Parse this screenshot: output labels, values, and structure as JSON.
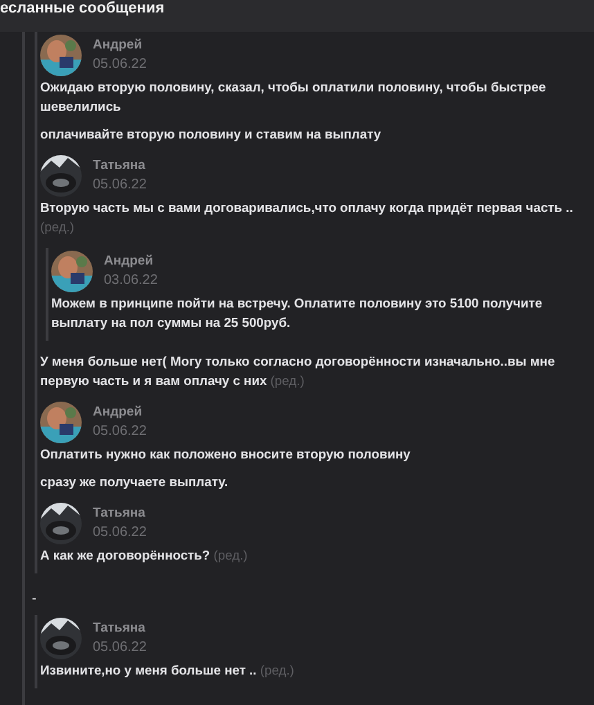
{
  "header": {
    "title": "есланные сообщения"
  },
  "items": [
    {
      "kind": "forward",
      "messages": [
        {
          "author": "Андрей",
          "date": "05.06.22",
          "avatar": {
            "kind": "picture"
          },
          "body": [
            {
              "kind": "text",
              "text": "Ожидаю вторую половину, сказал, чтобы оплатили половину, чтобы быстрее шевелились"
            },
            {
              "kind": "text",
              "text": "оплачивайте вторую половину и ставим на выплату"
            }
          ]
        },
        {
          "author": "Татьяна",
          "date": "05.06.22",
          "avatar": {
            "kind": "picture"
          },
          "body": [
            {
              "kind": "text",
              "text": "Вторую часть мы с вами договаривались,что оплачу когда придёт первая часть ..",
              "edit_mark": "(ред.)"
            },
            {
              "kind": "forward",
              "messages": [
                {
                  "author": "Андрей",
                  "date": "03.06.22",
                  "avatar": {
                    "kind": "picture"
                  },
                  "body": [
                    {
                      "kind": "text",
                      "text": "Можем в принципе пойти на встречу. Оплатите половину это 5100 получите выплату на пол суммы на 25 500руб."
                    }
                  ]
                }
              ]
            },
            {
              "kind": "text",
              "text": "У меня больше нет( Могу только согласно договорённости изначально..вы мне первую часть и я вам оплачу с них",
              "edit_mark": "(ред.)"
            }
          ]
        },
        {
          "author": "Андрей",
          "date": "05.06.22",
          "avatar": {
            "kind": "picture"
          },
          "body": [
            {
              "kind": "text",
              "text": "Оплатить нужно как положено вносите вторую половину"
            },
            {
              "kind": "text",
              "text": "сразу же получаете выплату."
            }
          ]
        },
        {
          "author": "Татьяна",
          "date": "05.06.22",
          "avatar": {
            "kind": "picture"
          },
          "body": [
            {
              "kind": "text",
              "text": "А как же договорённость?",
              "edit_mark": "(ред.)"
            }
          ]
        }
      ]
    },
    {
      "kind": "text",
      "text": "-"
    },
    {
      "kind": "forward",
      "messages": [
        {
          "author": "Татьяна",
          "date": "05.06.22",
          "avatar": {
            "kind": "picture"
          },
          "body": [
            {
              "kind": "text",
              "text": "Извините,но у меня больше нет ..",
              "edit_mark": "(ред.)"
            }
          ]
        }
      ]
    }
  ]
}
